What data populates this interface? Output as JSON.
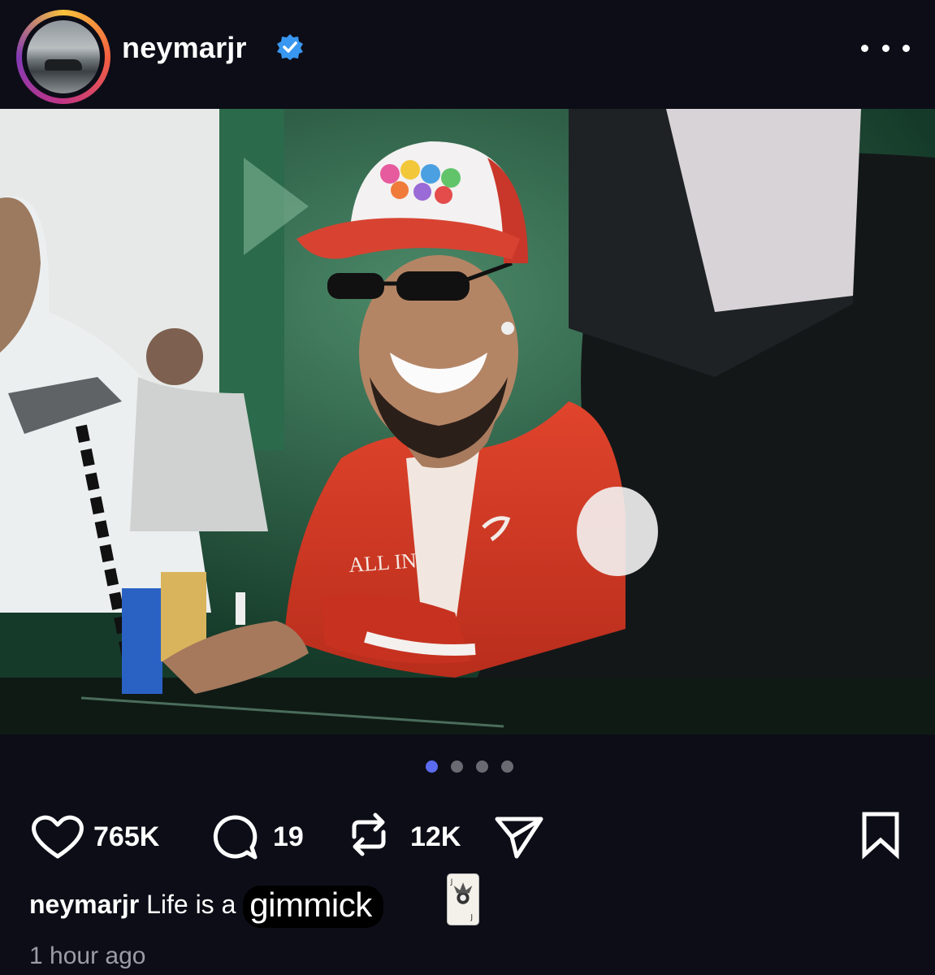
{
  "post": {
    "username": "neymarjr",
    "verified": true,
    "more_icon": "more-horizontal-icon",
    "image_text": "ALL IN",
    "carousel": {
      "count": 4,
      "active_index": 0
    },
    "likes": "765K",
    "comments": "19",
    "reposts": "12K",
    "caption_user": "neymarjr",
    "caption_text": "Life is a",
    "caption_sticker": "gimmick",
    "timestamp": "1 hour ago"
  },
  "icons": {
    "like": "heart-icon",
    "comment": "comment-icon",
    "repost": "repost-icon",
    "share": "send-icon",
    "save": "bookmark-icon",
    "card": "joker-card-icon"
  },
  "colors": {
    "background": "#0d0d17",
    "active_dot": "#5b6cf0",
    "inactive_dot": "#6a6a72",
    "verified": "#3897f0"
  }
}
